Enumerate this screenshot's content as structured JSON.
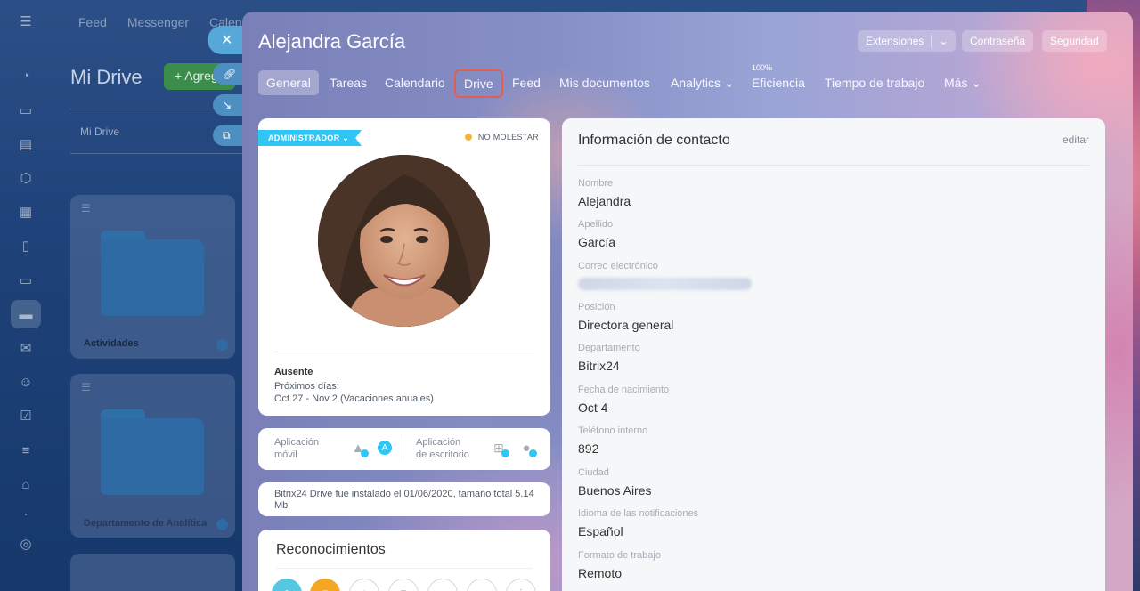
{
  "bg_page": {
    "top_menu": [
      "Feed",
      "Messenger",
      "Calend"
    ],
    "drive_title": "Mi Drive",
    "add_button": "+ Agreg",
    "breadcrumb": "Mi Drive",
    "folders": [
      {
        "name": "Actividades"
      },
      {
        "name": "Departamento de Analítica"
      }
    ]
  },
  "panel": {
    "title": "Alejandra García",
    "header_buttons": {
      "extensions": "Extensiones",
      "password": "Contraseña",
      "security": "Seguridad"
    },
    "tabs": [
      {
        "label": "General"
      },
      {
        "label": "Tareas"
      },
      {
        "label": "Calendario"
      },
      {
        "label": "Drive"
      },
      {
        "label": "Feed"
      },
      {
        "label": "Mis documentos"
      },
      {
        "label": "Analytics ⌄"
      },
      {
        "label": "Eficiencia",
        "sup": "100%"
      },
      {
        "label": "Tiempo de trabajo"
      },
      {
        "label": "Más ⌄"
      }
    ]
  },
  "profile": {
    "role": "ADMINISTRADOR ⌄",
    "status": "NO MOLESTAR",
    "absence_title": "Ausente",
    "absence_next": "Próximos días:",
    "absence_dates": "Oct 27 - Nov 2 (Vacaciones anuales)"
  },
  "apps": {
    "mobile": "Aplicación\nmóvil",
    "desktop": "Aplicación\nde escritorio"
  },
  "install": {
    "text": "Bitrix24 Drive fue instalado el 01/06/2020, tamaño total 5.14 Mb"
  },
  "recognitions": {
    "title": "Reconocimientos"
  },
  "contact": {
    "title": "Información de contacto",
    "edit": "editar",
    "fields": [
      {
        "label": "Nombre",
        "value": "Alejandra"
      },
      {
        "label": "Apellido",
        "value": "García"
      },
      {
        "label": "Correo electrónico",
        "value": ""
      },
      {
        "label": "Posición",
        "value": "Directora general"
      },
      {
        "label": "Departamento",
        "value": "Bitrix24"
      },
      {
        "label": "Fecha de nacimiento",
        "value": "Oct 4"
      },
      {
        "label": "Teléfono interno",
        "value": "892"
      },
      {
        "label": "Ciudad",
        "value": "Buenos Aires"
      },
      {
        "label": "Idioma de las notificaciones",
        "value": "Español"
      },
      {
        "label": "Formato de trabajo",
        "value": "Remoto"
      }
    ]
  },
  "colors": {
    "accent": "#2fc6f6",
    "highlight_border": "#e35d50",
    "status_dnd": "#f6b43c"
  }
}
